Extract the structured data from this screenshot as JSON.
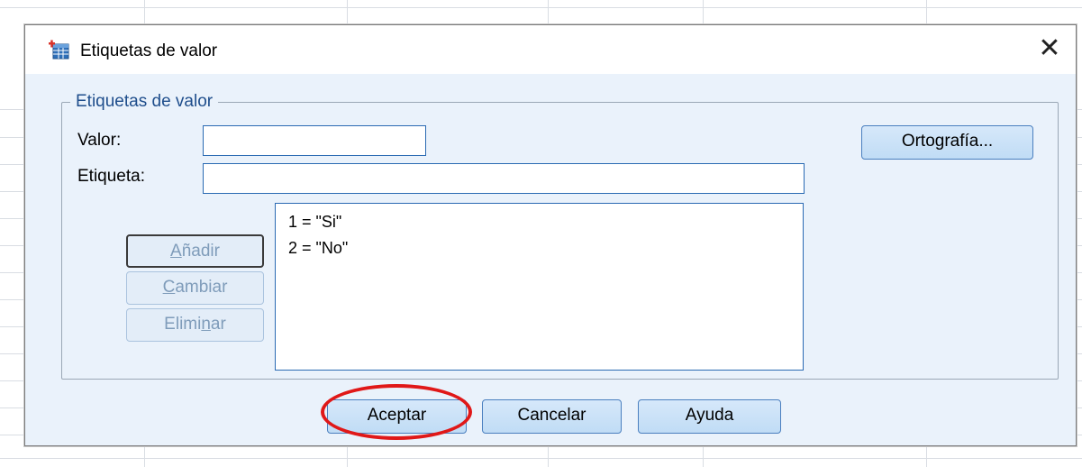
{
  "dialog": {
    "title": "Etiquetas de valor",
    "close_symbol": "✕",
    "group_title": "Etiquetas de valor",
    "valor_label": "Valor:",
    "valor_value": "",
    "etiqueta_label": "Etiqueta:",
    "etiqueta_value": "",
    "spelling_button": "Ortografía...",
    "list_items": [
      "1 = \"Si\"",
      "2 = \"No\""
    ],
    "add_button": {
      "mnemonic": "A",
      "rest": "ñadir",
      "enabled": false
    },
    "change_button": {
      "mnemonic": "C",
      "rest": "ambiar",
      "enabled": false
    },
    "delete_button": {
      "before": "Elimi",
      "mnemonic": "n",
      "after": "ar",
      "enabled": false
    },
    "ok_button": "Aceptar",
    "cancel_button": "Cancelar",
    "help_button": "Ayuda"
  },
  "colors": {
    "highlight_ring": "#e01818",
    "dialog_background": "#eaf2fb",
    "group_title": "#1f4e8c"
  }
}
